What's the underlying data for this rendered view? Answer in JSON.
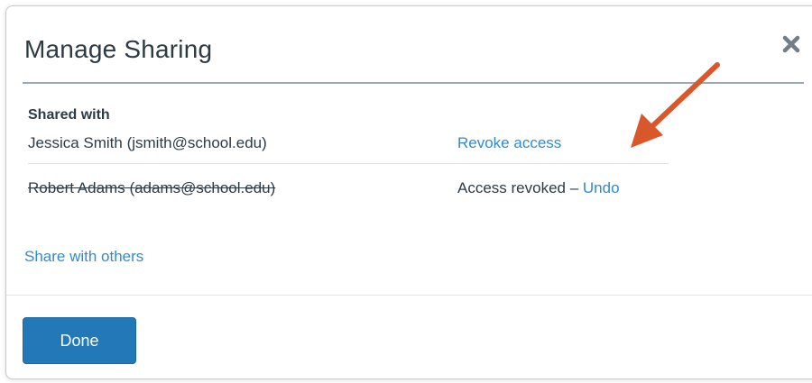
{
  "dialog": {
    "title": "Manage Sharing",
    "close_icon": "close-icon",
    "shared_with_label": "Shared with",
    "shares": [
      {
        "name": "Jessica Smith (jsmith@school.edu)",
        "action_link": "Revoke access",
        "revoked": false
      },
      {
        "name": "Robert Adams (adams@school.edu)",
        "status_text": "Access revoked – ",
        "undo_link": "Undo",
        "revoked": true
      }
    ],
    "share_with_others": "Share with others",
    "done_label": "Done"
  },
  "colors": {
    "link": "#2e8bd6",
    "primary_button": "#2378b7",
    "annotation_arrow": "#d9582b",
    "header_rule": "#9aa7b4"
  }
}
